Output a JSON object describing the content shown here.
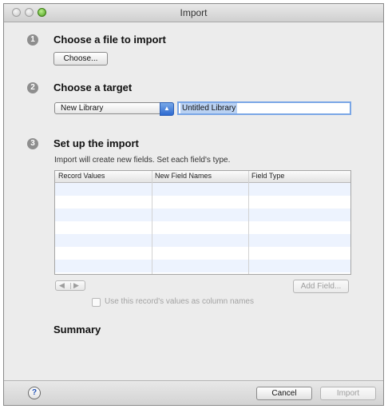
{
  "window": {
    "title": "Import"
  },
  "steps": [
    {
      "number": "1",
      "heading": "Choose a file to import"
    },
    {
      "number": "2",
      "heading": "Choose a target"
    },
    {
      "number": "3",
      "heading": "Set up the import"
    }
  ],
  "choose_button": "Choose...",
  "target": {
    "selected": "New Library",
    "name_value": "Untitled Library"
  },
  "setup": {
    "description": "Import will create new fields. Set each field's type.",
    "columns": [
      "Record Values",
      "New Field Names",
      "Field Type"
    ]
  },
  "add_field_button": "Add Field...",
  "stepper": {
    "prev": "◀",
    "next": "▶"
  },
  "checkbox_label": "Use this record's values as column names",
  "summary_heading": "Summary",
  "footer": {
    "help": "?",
    "cancel": "Cancel",
    "import": "Import"
  },
  "icons": {
    "popup": "up-down-arrows",
    "help": "help-icon"
  }
}
